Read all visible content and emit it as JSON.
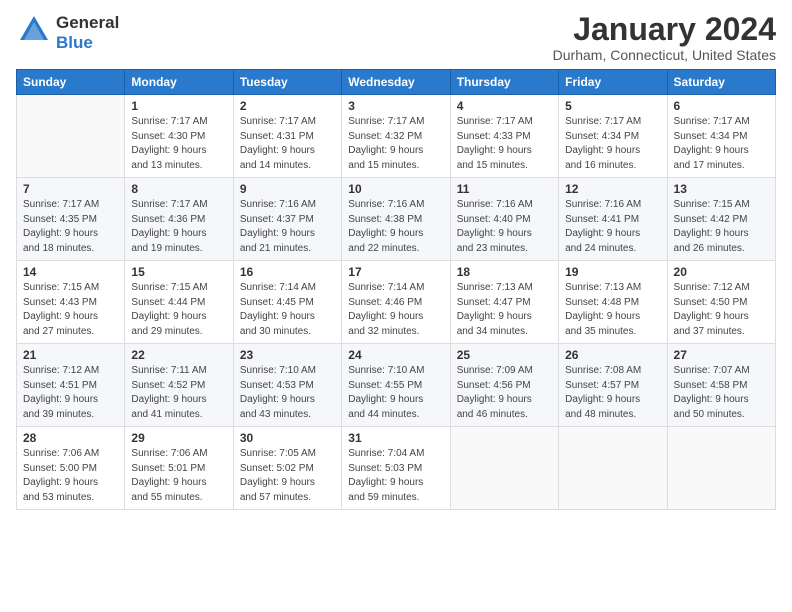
{
  "header": {
    "logo_general": "General",
    "logo_blue": "Blue",
    "title": "January 2024",
    "subtitle": "Durham, Connecticut, United States"
  },
  "days_of_week": [
    "Sunday",
    "Monday",
    "Tuesday",
    "Wednesday",
    "Thursday",
    "Friday",
    "Saturday"
  ],
  "weeks": [
    [
      {
        "num": "",
        "sunrise": "",
        "sunset": "",
        "daylight": ""
      },
      {
        "num": "1",
        "sunrise": "Sunrise: 7:17 AM",
        "sunset": "Sunset: 4:30 PM",
        "daylight": "Daylight: 9 hours and 13 minutes."
      },
      {
        "num": "2",
        "sunrise": "Sunrise: 7:17 AM",
        "sunset": "Sunset: 4:31 PM",
        "daylight": "Daylight: 9 hours and 14 minutes."
      },
      {
        "num": "3",
        "sunrise": "Sunrise: 7:17 AM",
        "sunset": "Sunset: 4:32 PM",
        "daylight": "Daylight: 9 hours and 15 minutes."
      },
      {
        "num": "4",
        "sunrise": "Sunrise: 7:17 AM",
        "sunset": "Sunset: 4:33 PM",
        "daylight": "Daylight: 9 hours and 15 minutes."
      },
      {
        "num": "5",
        "sunrise": "Sunrise: 7:17 AM",
        "sunset": "Sunset: 4:34 PM",
        "daylight": "Daylight: 9 hours and 16 minutes."
      },
      {
        "num": "6",
        "sunrise": "Sunrise: 7:17 AM",
        "sunset": "Sunset: 4:34 PM",
        "daylight": "Daylight: 9 hours and 17 minutes."
      }
    ],
    [
      {
        "num": "7",
        "sunrise": "Sunrise: 7:17 AM",
        "sunset": "Sunset: 4:35 PM",
        "daylight": "Daylight: 9 hours and 18 minutes."
      },
      {
        "num": "8",
        "sunrise": "Sunrise: 7:17 AM",
        "sunset": "Sunset: 4:36 PM",
        "daylight": "Daylight: 9 hours and 19 minutes."
      },
      {
        "num": "9",
        "sunrise": "Sunrise: 7:16 AM",
        "sunset": "Sunset: 4:37 PM",
        "daylight": "Daylight: 9 hours and 21 minutes."
      },
      {
        "num": "10",
        "sunrise": "Sunrise: 7:16 AM",
        "sunset": "Sunset: 4:38 PM",
        "daylight": "Daylight: 9 hours and 22 minutes."
      },
      {
        "num": "11",
        "sunrise": "Sunrise: 7:16 AM",
        "sunset": "Sunset: 4:40 PM",
        "daylight": "Daylight: 9 hours and 23 minutes."
      },
      {
        "num": "12",
        "sunrise": "Sunrise: 7:16 AM",
        "sunset": "Sunset: 4:41 PM",
        "daylight": "Daylight: 9 hours and 24 minutes."
      },
      {
        "num": "13",
        "sunrise": "Sunrise: 7:15 AM",
        "sunset": "Sunset: 4:42 PM",
        "daylight": "Daylight: 9 hours and 26 minutes."
      }
    ],
    [
      {
        "num": "14",
        "sunrise": "Sunrise: 7:15 AM",
        "sunset": "Sunset: 4:43 PM",
        "daylight": "Daylight: 9 hours and 27 minutes."
      },
      {
        "num": "15",
        "sunrise": "Sunrise: 7:15 AM",
        "sunset": "Sunset: 4:44 PM",
        "daylight": "Daylight: 9 hours and 29 minutes."
      },
      {
        "num": "16",
        "sunrise": "Sunrise: 7:14 AM",
        "sunset": "Sunset: 4:45 PM",
        "daylight": "Daylight: 9 hours and 30 minutes."
      },
      {
        "num": "17",
        "sunrise": "Sunrise: 7:14 AM",
        "sunset": "Sunset: 4:46 PM",
        "daylight": "Daylight: 9 hours and 32 minutes."
      },
      {
        "num": "18",
        "sunrise": "Sunrise: 7:13 AM",
        "sunset": "Sunset: 4:47 PM",
        "daylight": "Daylight: 9 hours and 34 minutes."
      },
      {
        "num": "19",
        "sunrise": "Sunrise: 7:13 AM",
        "sunset": "Sunset: 4:48 PM",
        "daylight": "Daylight: 9 hours and 35 minutes."
      },
      {
        "num": "20",
        "sunrise": "Sunrise: 7:12 AM",
        "sunset": "Sunset: 4:50 PM",
        "daylight": "Daylight: 9 hours and 37 minutes."
      }
    ],
    [
      {
        "num": "21",
        "sunrise": "Sunrise: 7:12 AM",
        "sunset": "Sunset: 4:51 PM",
        "daylight": "Daylight: 9 hours and 39 minutes."
      },
      {
        "num": "22",
        "sunrise": "Sunrise: 7:11 AM",
        "sunset": "Sunset: 4:52 PM",
        "daylight": "Daylight: 9 hours and 41 minutes."
      },
      {
        "num": "23",
        "sunrise": "Sunrise: 7:10 AM",
        "sunset": "Sunset: 4:53 PM",
        "daylight": "Daylight: 9 hours and 43 minutes."
      },
      {
        "num": "24",
        "sunrise": "Sunrise: 7:10 AM",
        "sunset": "Sunset: 4:55 PM",
        "daylight": "Daylight: 9 hours and 44 minutes."
      },
      {
        "num": "25",
        "sunrise": "Sunrise: 7:09 AM",
        "sunset": "Sunset: 4:56 PM",
        "daylight": "Daylight: 9 hours and 46 minutes."
      },
      {
        "num": "26",
        "sunrise": "Sunrise: 7:08 AM",
        "sunset": "Sunset: 4:57 PM",
        "daylight": "Daylight: 9 hours and 48 minutes."
      },
      {
        "num": "27",
        "sunrise": "Sunrise: 7:07 AM",
        "sunset": "Sunset: 4:58 PM",
        "daylight": "Daylight: 9 hours and 50 minutes."
      }
    ],
    [
      {
        "num": "28",
        "sunrise": "Sunrise: 7:06 AM",
        "sunset": "Sunset: 5:00 PM",
        "daylight": "Daylight: 9 hours and 53 minutes."
      },
      {
        "num": "29",
        "sunrise": "Sunrise: 7:06 AM",
        "sunset": "Sunset: 5:01 PM",
        "daylight": "Daylight: 9 hours and 55 minutes."
      },
      {
        "num": "30",
        "sunrise": "Sunrise: 7:05 AM",
        "sunset": "Sunset: 5:02 PM",
        "daylight": "Daylight: 9 hours and 57 minutes."
      },
      {
        "num": "31",
        "sunrise": "Sunrise: 7:04 AM",
        "sunset": "Sunset: 5:03 PM",
        "daylight": "Daylight: 9 hours and 59 minutes."
      },
      {
        "num": "",
        "sunrise": "",
        "sunset": "",
        "daylight": ""
      },
      {
        "num": "",
        "sunrise": "",
        "sunset": "",
        "daylight": ""
      },
      {
        "num": "",
        "sunrise": "",
        "sunset": "",
        "daylight": ""
      }
    ]
  ]
}
